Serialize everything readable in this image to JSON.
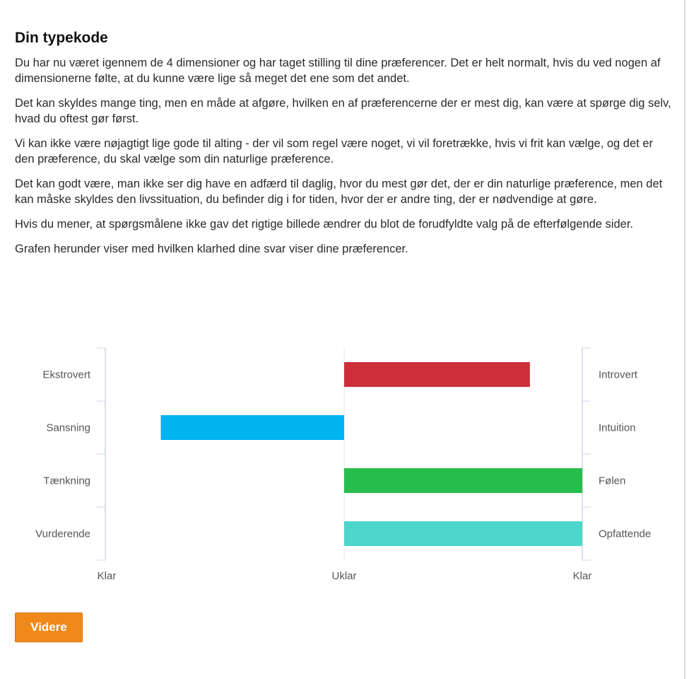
{
  "page": {
    "title": "Din typekode",
    "paragraphs": [
      "Du har nu været igennem de 4 dimensioner og har taget stilling til dine præferencer. Det er helt normalt, hvis du ved nogen af dimensionerne følte, at du kunne være lige så meget det ene som det andet.",
      "Det kan skyldes mange ting, men en måde at afgøre, hvilken en af præferencerne der er mest dig, kan være at spørge dig selv, hvad du oftest gør først.",
      "Vi kan ikke være nøjagtigt lige gode til alting - der vil som regel være noget, vi vil foretrække, hvis vi frit kan vælge, og det er den præference, du skal vælge som din naturlige præference.",
      "Det kan godt være, man ikke ser dig have en adfærd til daglig, hvor du mest gør det, der er din naturlige præference, men det kan måske skyldes den livssituation, du befinder dig i for tiden, hvor der er andre ting, der er nødvendige at gøre.",
      "Hvis du mener, at spørgsmålene ikke gav det rigtige billede ændrer du blot de forudfyldte valg på de efterfølgende sider.",
      "Grafen herunder viser med hvilken klarhed dine svar viser dine præferencer."
    ]
  },
  "chart_data": {
    "type": "bar",
    "orientation": "horizontal-diverging",
    "xlim": [
      -1,
      1
    ],
    "x_tick_labels": [
      "Klar",
      "Uklar",
      "Klar"
    ],
    "grid": false,
    "rows": [
      {
        "left_label": "Ekstrovert",
        "right_label": "Introvert",
        "value": 0.78,
        "color": "#cc2f3a"
      },
      {
        "left_label": "Sansning",
        "right_label": "Intuition",
        "value": -0.77,
        "color": "#00b4ef"
      },
      {
        "left_label": "Tænkning",
        "right_label": "Følen",
        "value": 1.0,
        "color": "#27bd4b"
      },
      {
        "left_label": "Vurderende",
        "right_label": "Opfattende",
        "value": 1.0,
        "color": "#4cd6cc"
      }
    ]
  },
  "button": {
    "label": "Videre",
    "color": "#f0891a"
  }
}
